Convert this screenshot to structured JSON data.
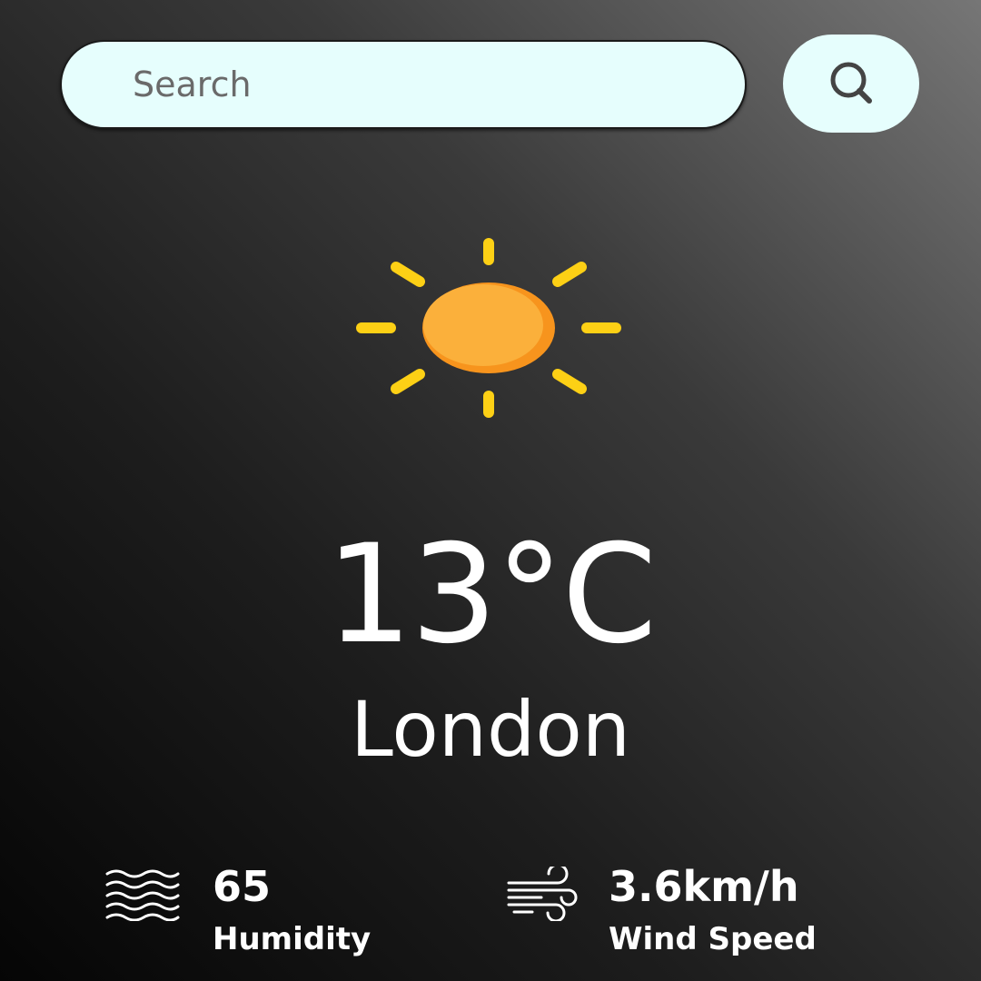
{
  "search": {
    "placeholder": "Search",
    "value": "",
    "button_icon": "search-icon"
  },
  "weather": {
    "condition_icon": "sun-icon",
    "temperature": "13°C",
    "city": "London"
  },
  "stats": {
    "humidity": {
      "icon": "humidity-waves-icon",
      "value": "65",
      "label": "Humidity"
    },
    "wind": {
      "icon": "wind-icon",
      "value": "3.6km/h",
      "label": "Wind Speed"
    }
  },
  "colors": {
    "search_bg": "#e6fefd",
    "sun_rays": "#fdd015",
    "sun_core": "#fbb03b",
    "sun_shade": "#f7941d",
    "text": "#ffffff"
  }
}
